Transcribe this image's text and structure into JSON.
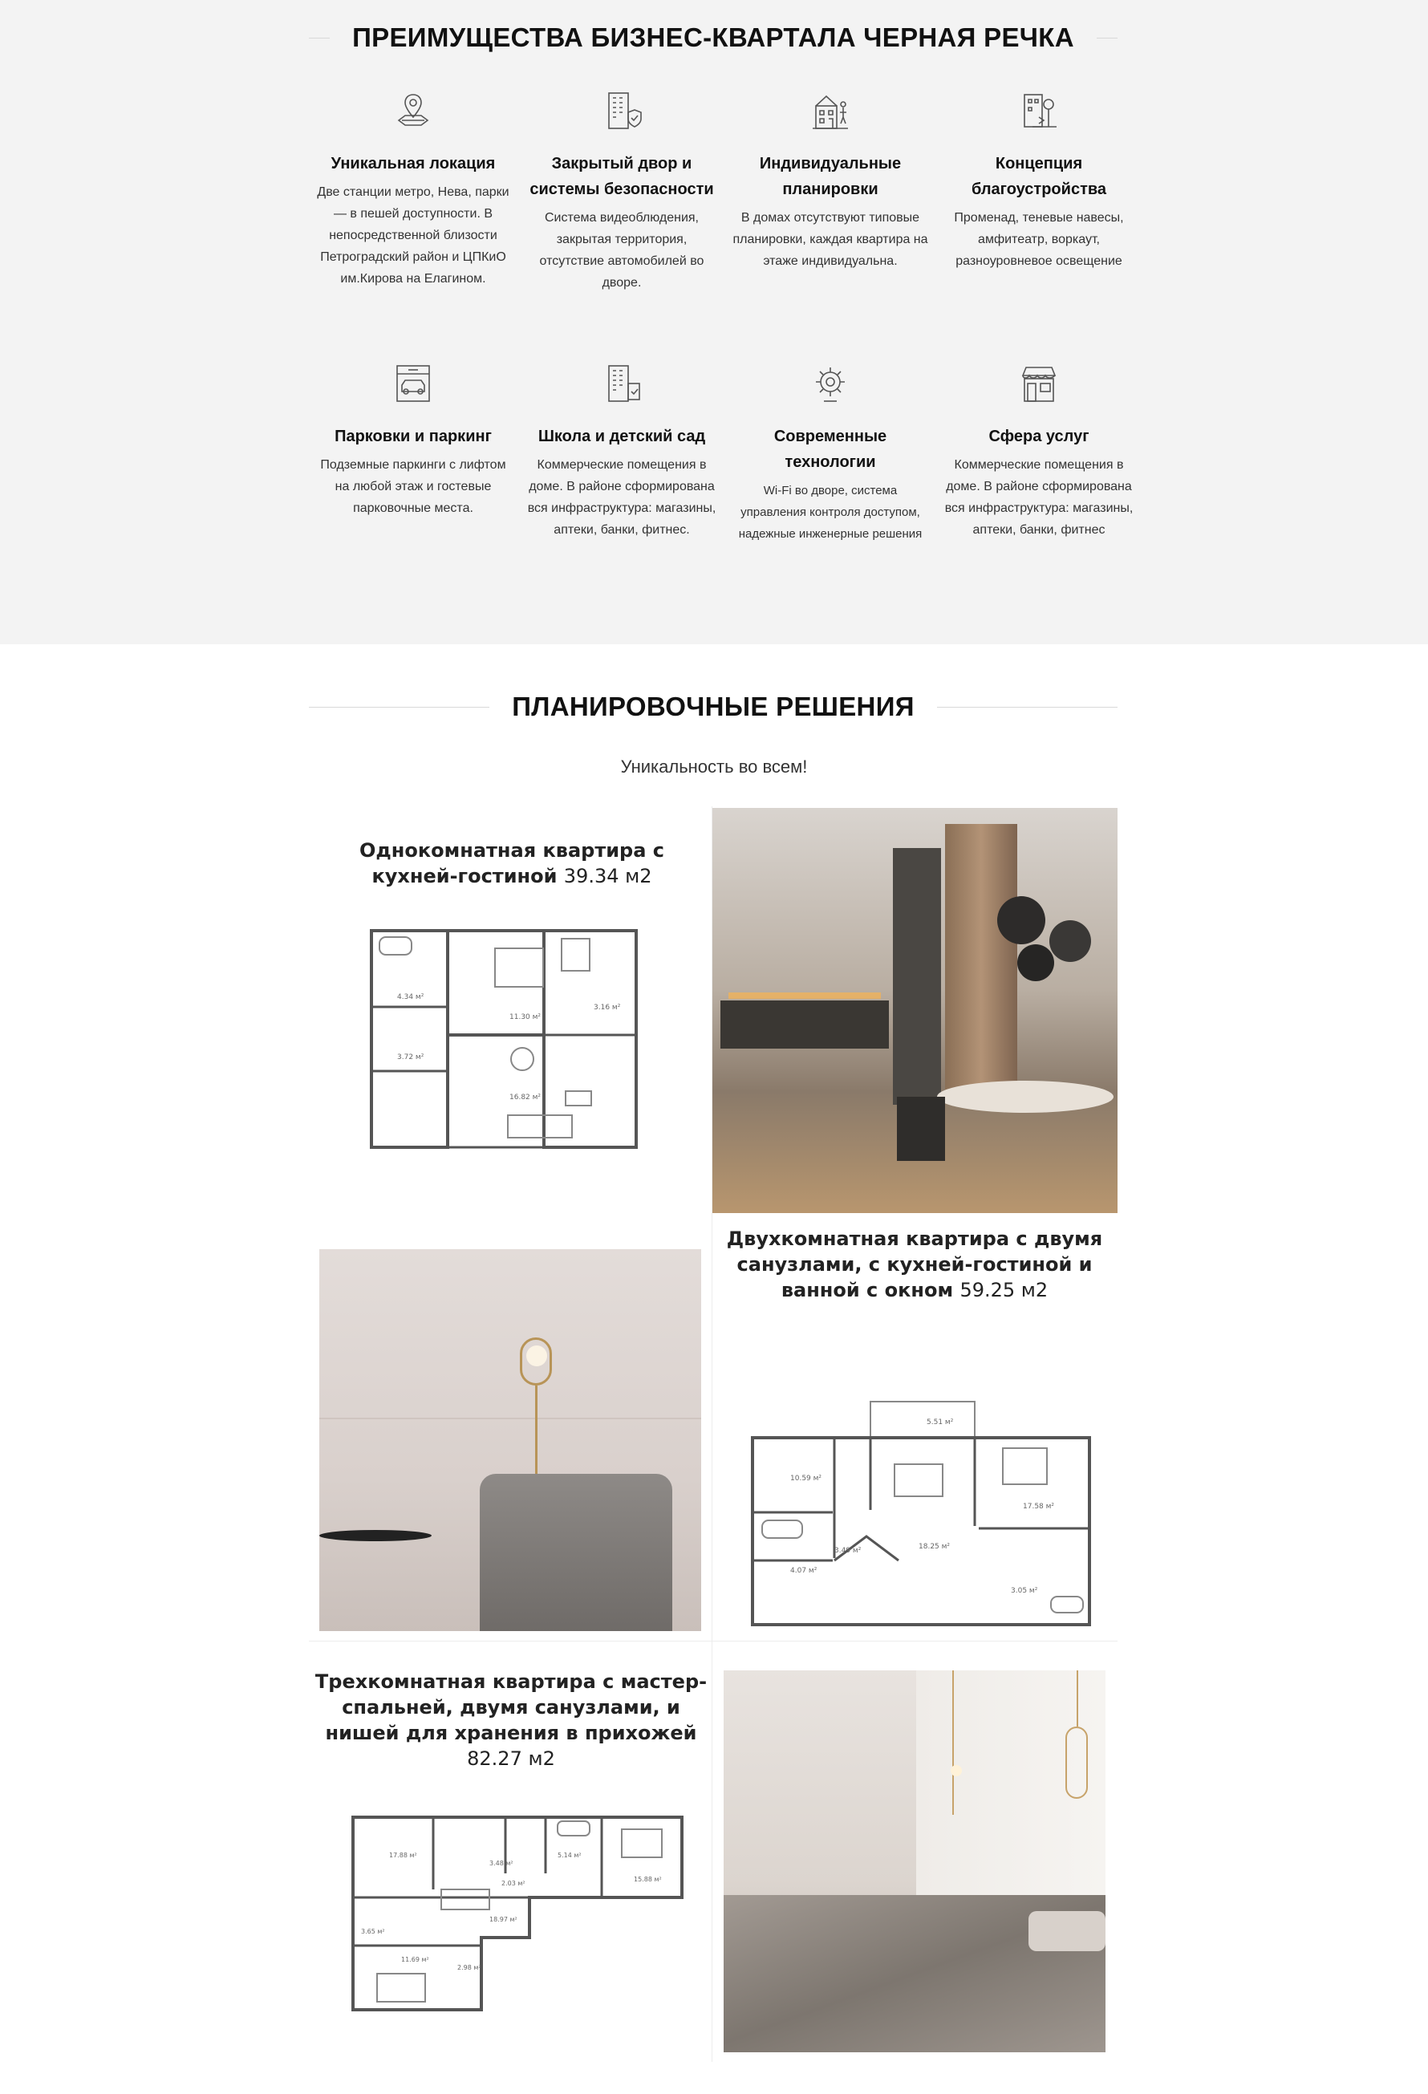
{
  "advantages": {
    "title": "ПРЕИМУЩЕСТВА БИЗНЕС-КВАРТАЛА ЧЕРНАЯ РЕЧКА",
    "items": [
      {
        "icon": "location-icon",
        "name": "Уникальная локация",
        "desc": "Две станции метро, Нева, парки — в пешей доступности. В непосредственной близости Петроградский район и ЦПКиО им.Кирова на Елагином."
      },
      {
        "icon": "secure-building-icon",
        "name": "Закрытый двор и системы безопасности",
        "desc": "Система видеоблюдения, закрытая территория, отсутствие автомобилей во дворе."
      },
      {
        "icon": "floorplan-building-icon",
        "name": "Индивидуальные планировки",
        "desc": "В домах отсутствуют типовые планировки, каждая квартира на этаже индивидуальна."
      },
      {
        "icon": "landscape-icon",
        "name": "Концепция благоустройства",
        "desc": "Променад, теневые навесы, амфитеатр, воркаут, разноуровневое освещение"
      },
      {
        "icon": "parking-icon",
        "name": "Парковки и паркинг",
        "desc": "Подземные паркинги с лифтом на любой этаж и гостевые парковочные места."
      },
      {
        "icon": "school-building-icon",
        "name": "Школа и детский сад",
        "desc": "Коммерческие помещения в доме. В районе сформирована вся инфраструктура: магазины, аптеки, банки, фитнес."
      },
      {
        "icon": "tech-gear-icon",
        "name": "Современные технологии",
        "desc": "Wi-Fi во дворе, система управления контроля доступом, надежные инженерные решения"
      },
      {
        "icon": "storefront-icon",
        "name": "Сфера услуг",
        "desc": "Коммерческие помещения в доме. В районе сформирована вся инфраструктура: магазины, аптеки, банки, фитнес"
      }
    ]
  },
  "plans": {
    "title": "ПЛАНИРОВОЧНЫЕ РЕШЕНИЯ",
    "subtitle": "Уникальность во всем!",
    "items": [
      {
        "title": "Однокомнатная квартира с кухней-гостиной",
        "area": "39.34 м2",
        "rooms": [
          "4.34 м²",
          "11.30 м²",
          "3.16 м²",
          "3.72 м²",
          "16.82 м²"
        ]
      },
      {
        "title": "Двухкомнатная квартира с двумя санузлами, с кухней-гостиной и ванной с окном",
        "area": "59.25 м2",
        "rooms": [
          "5.51 м²",
          "10.59 м²",
          "17.58 м²",
          "4.07 м²",
          "3.49 м²",
          "18.25 м²",
          "3.05 м²"
        ]
      },
      {
        "title": "Трехкомнатная квартира с мастер-спальней, двумя санузлами, и нишей для хранения в прихожей",
        "area": "82.27 м2",
        "rooms": [
          "17.88 м²",
          "3.48 м²",
          "5.14 м²",
          "15.88 м²",
          "18.97 м²",
          "2.03 м²",
          "3.65 м²",
          "11.69 м²",
          "2.98 м²"
        ]
      }
    ]
  }
}
